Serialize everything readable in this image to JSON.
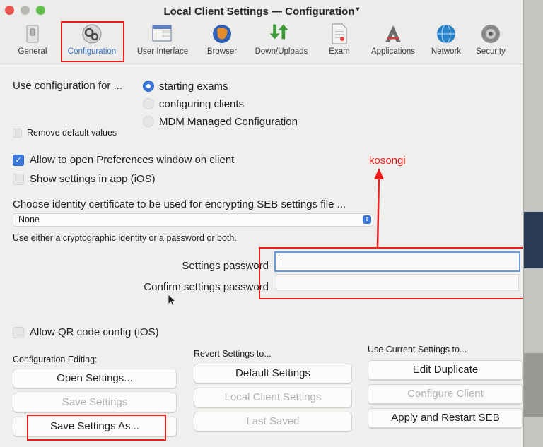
{
  "window": {
    "title": "Local Client Settings — Configuration",
    "title_mark": "▾"
  },
  "toolbar": {
    "items": [
      {
        "label": "General",
        "icon": "switch-icon"
      },
      {
        "label": "Configuration",
        "icon": "gears-icon"
      },
      {
        "label": "User Interface",
        "icon": "user-interface-icon"
      },
      {
        "label": "Browser",
        "icon": "globe-icon"
      },
      {
        "label": "Down/Uploads",
        "icon": "down-up-arrows-icon"
      },
      {
        "label": "Exam",
        "icon": "document-icon"
      },
      {
        "label": "Applications",
        "icon": "applications-icon"
      },
      {
        "label": "Network",
        "icon": "network-globe-icon"
      },
      {
        "label": "Security",
        "icon": "security-icon"
      }
    ],
    "selected": "Configuration"
  },
  "config": {
    "use_for_label": "Use configuration for ...",
    "options": [
      "starting exams",
      "configuring clients",
      "MDM Managed Configuration"
    ],
    "selected_option": "starting exams",
    "remove_defaults": "Remove default values",
    "allow_prefs": "Allow to open Preferences window on client",
    "show_settings_ios": "Show settings in app (iOS)",
    "identity_label": "Choose identity certificate to be used for encrypting SEB settings file ...",
    "identity_value": "None",
    "identity_hint": "Use either a cryptographic identity or a password or both.",
    "settings_password_label": "Settings password",
    "confirm_password_label": "Confirm settings password",
    "settings_password_value": "",
    "confirm_password_value": "",
    "allow_qr": "Allow QR code config (iOS)"
  },
  "sections": {
    "editing": {
      "title": "Configuration Editing:",
      "buttons": [
        "Open Settings...",
        "Save Settings",
        "Save Settings As..."
      ]
    },
    "revert": {
      "title": "Revert Settings to...",
      "buttons": [
        "Default Settings",
        "Local Client Settings",
        "Last Saved"
      ]
    },
    "current": {
      "title": "Use Current Settings to...",
      "buttons": [
        "Edit Duplicate",
        "Configure Client",
        "Apply and Restart SEB"
      ]
    }
  },
  "annotation": {
    "text": "kosongi",
    "color": "#ee1c1c"
  },
  "colors": {
    "accent": "#3c78d8",
    "annotation": "#ee1c1c"
  }
}
